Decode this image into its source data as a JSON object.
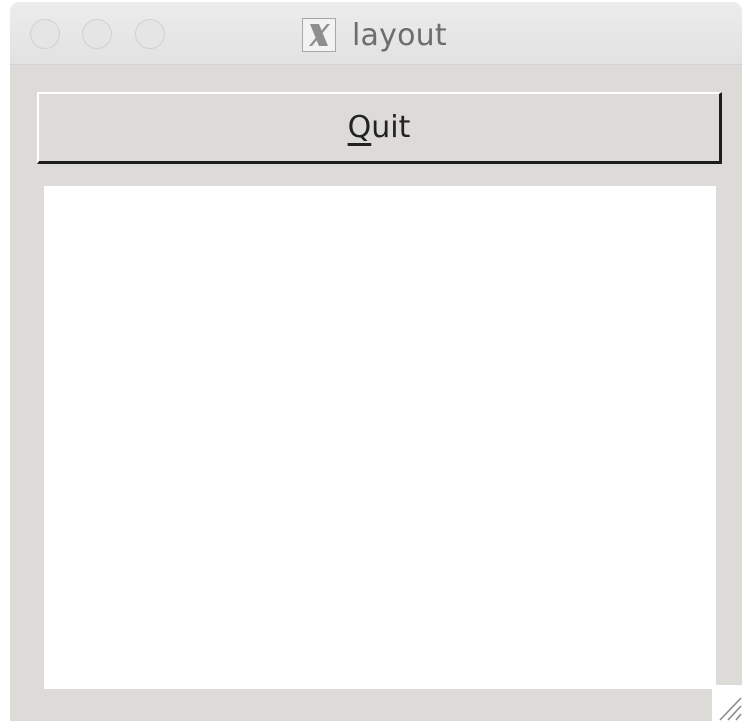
{
  "window": {
    "title": "layout",
    "app_icon": "x11-icon",
    "background_color": "#dcdbd7"
  },
  "titlebar": {
    "buttons": [
      "close",
      "minimize",
      "zoom"
    ],
    "buttons_state": "inactive"
  },
  "toolbar": {
    "quit_mnemonic": "Q",
    "quit_rest": "uit"
  },
  "canvas": {
    "background_color": "#ffffff"
  }
}
